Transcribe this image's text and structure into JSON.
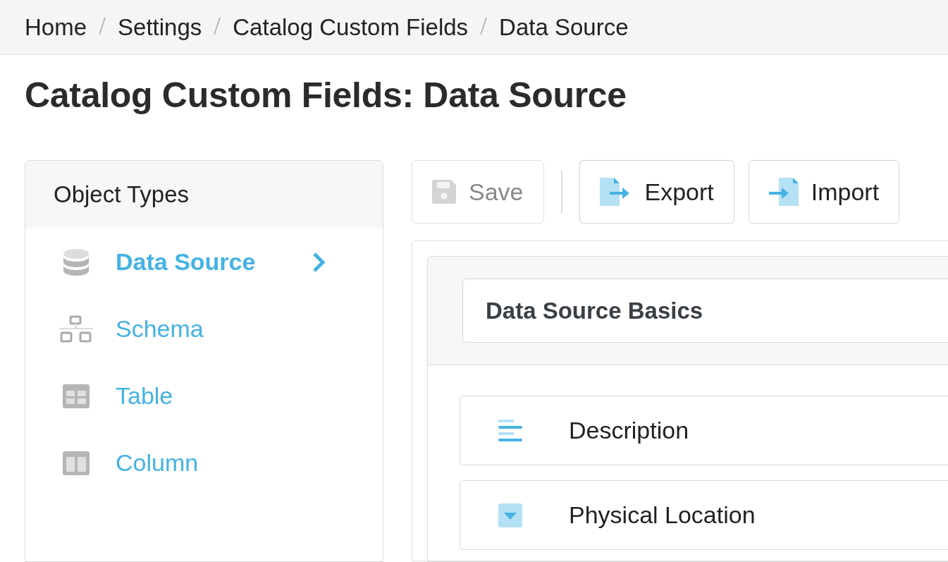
{
  "breadcrumb": [
    "Home",
    "Settings",
    "Catalog Custom Fields",
    "Data Source"
  ],
  "title": "Catalog Custom Fields: Data Source",
  "sidebar": {
    "title": "Object Types",
    "items": [
      {
        "label": "Data Source",
        "kind": "database",
        "selected": true
      },
      {
        "label": "Schema",
        "kind": "schema",
        "selected": false
      },
      {
        "label": "Table",
        "kind": "table",
        "selected": false
      },
      {
        "label": "Column",
        "kind": "column",
        "selected": false
      }
    ]
  },
  "toolbar": [
    {
      "label": "Save",
      "kind": "save",
      "disabled": true
    },
    {
      "label": "Export",
      "kind": "export",
      "disabled": false
    },
    {
      "label": "Import",
      "kind": "import",
      "disabled": false
    }
  ],
  "section": {
    "title": "Data Source Basics",
    "fields": [
      {
        "label": "Description",
        "kind": "text"
      },
      {
        "label": "Physical Location",
        "kind": "dropdown"
      }
    ]
  }
}
